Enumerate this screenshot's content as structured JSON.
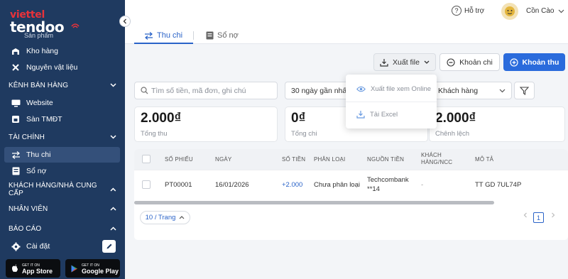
{
  "brand": {
    "top": "viettel",
    "name": "tendoo"
  },
  "sidebar": {
    "cut_label": "Sản phẩm",
    "items": [
      {
        "label": "Kho hàng",
        "icon": "warehouse-icon"
      },
      {
        "label": "Nguyên vật liệu",
        "icon": "tools-icon"
      },
      {
        "label": "Website",
        "icon": "monitor-icon"
      },
      {
        "label": "Sàn TMĐT",
        "icon": "store-icon"
      },
      {
        "label": "Thu chi",
        "icon": "exchange-icon",
        "active": true
      },
      {
        "label": "Sổ nợ",
        "icon": "book-icon"
      },
      {
        "label": "Cài đặt",
        "icon": "gear-icon"
      }
    ],
    "sections": [
      {
        "label": "KÊNH BÁN HÀNG",
        "expanded": true
      },
      {
        "label": "TÀI CHÍNH",
        "expanded": true
      },
      {
        "label": "KHÁCH HÀNG/NHÀ CUNG CẤP",
        "expanded": false
      },
      {
        "label": "NHÂN VIÊN",
        "expanded": false
      },
      {
        "label": "BÁO CÁO",
        "expanded": false
      }
    ],
    "stores": [
      {
        "small": "GET IT ON",
        "big": "App Store"
      },
      {
        "small": "GET IT ON",
        "big": "Google Play"
      }
    ]
  },
  "header": {
    "help": "Hỗ trợ",
    "user": "Cồn Cào",
    "tabs": [
      {
        "label": "Thu chi",
        "active": true
      },
      {
        "label": "Sổ nợ",
        "active": false
      }
    ]
  },
  "actions": {
    "export": "Xuất file",
    "expense": "Khoản chi",
    "income": "Khoản thu"
  },
  "export_menu": {
    "items": [
      "Xuất file xem Online",
      "Tải Excel"
    ]
  },
  "filters": {
    "search_placeholder": "Tìm số tiền, mã đơn, ghi chú",
    "date_range": "30 ngày gần nhất",
    "customer": "Khách hàng"
  },
  "stats": [
    {
      "amount": "2.000₫",
      "label": "Tổng thu"
    },
    {
      "amount": "0₫",
      "label": "Tổng chi"
    },
    {
      "amount": "2.000₫",
      "label": "Chênh lệch"
    }
  ],
  "table": {
    "columns": [
      "SỐ PHIẾU",
      "NGÀY",
      "SỐ TIỀN",
      "PHÂN LOẠI",
      "NGUỒN TIỀN",
      "KHÁCH HÀNG/NCC",
      "MÔ TẢ"
    ],
    "rows": [
      {
        "code": "PT00001",
        "date": "16/01/2026",
        "amount": "+2.000",
        "category": "Chưa phân loại",
        "source": "Techcombank **14",
        "partner": "-",
        "description": "TT GD 7UL74P"
      }
    ],
    "per_page": "10 / Trang",
    "current_page": "1"
  },
  "colors": {
    "sidebar": "#1f3a60",
    "primary": "#2a6bdc",
    "brand_red": "#e8323a"
  }
}
